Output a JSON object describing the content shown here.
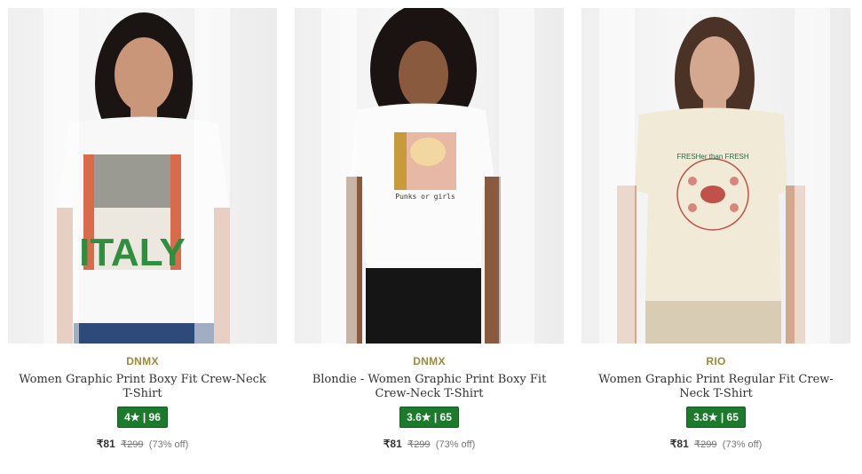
{
  "products": [
    {
      "brand": "DNMX",
      "title": "Women Graphic Print Boxy Fit Crew-Neck T-Shirt",
      "rating": "4★ | 96",
      "price": "₹81",
      "mrp": "₹299",
      "discount": "(73% off)",
      "print_text": "ITALY",
      "colors": {
        "shirt": "#f8f8f8",
        "hair": "#1a1413",
        "skin": "#c9967a",
        "pants": "#2d4a7a"
      }
    },
    {
      "brand": "DNMX",
      "title": "Blondie - Women Graphic Print Boxy Fit Crew-Neck T-Shirt",
      "rating": "3.6★ | 65",
      "price": "₹81",
      "mrp": "₹299",
      "discount": "(73% off)",
      "print_text": "Punks or girls",
      "colors": {
        "shirt": "#fbfbfb",
        "hair": "#1a1311",
        "skin": "#8a5a3e",
        "pants": "#151515"
      }
    },
    {
      "brand": "RIO",
      "title": "Women Graphic Print Regular Fit Crew-Neck T-Shirt",
      "rating": "3.8★ | 65",
      "price": "₹81",
      "mrp": "₹299",
      "discount": "(73% off)",
      "print_text": "FRESHer than FRESH",
      "colors": {
        "shirt": "#f1ead6",
        "hair": "#4a3226",
        "skin": "#d3a88e",
        "pants": "#d8ccb5"
      }
    }
  ]
}
